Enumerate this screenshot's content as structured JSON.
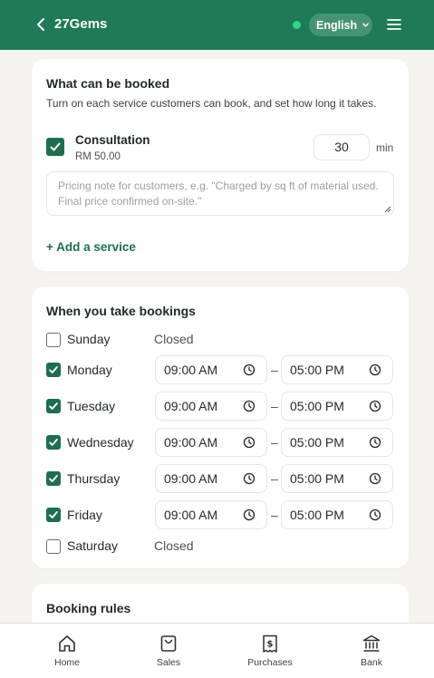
{
  "header": {
    "title": "27Gems",
    "language": "English",
    "colors": {
      "bar": "#1e7a57",
      "status_dot": "#2fd67f"
    }
  },
  "services_card": {
    "title": "What can be booked",
    "subtitle": "Turn on each service customers can book, and set how long it takes.",
    "services": [
      {
        "name": "Consultation",
        "price": "RM 50.00",
        "enabled": true,
        "duration": "30",
        "duration_unit": "min",
        "note_placeholder": "Pricing note for customers, e.g. \"Charged by sq ft of material used. Final price confirmed on-site.\""
      }
    ],
    "add_label": "+ Add a service"
  },
  "hours_card": {
    "title": "When you take bookings",
    "closed_label": "Closed",
    "separator": "–",
    "days": [
      {
        "name": "Sunday",
        "enabled": false,
        "start": "",
        "end": ""
      },
      {
        "name": "Monday",
        "enabled": true,
        "start": "09:00 AM",
        "end": "05:00 PM"
      },
      {
        "name": "Tuesday",
        "enabled": true,
        "start": "09:00 AM",
        "end": "05:00 PM"
      },
      {
        "name": "Wednesday",
        "enabled": true,
        "start": "09:00 AM",
        "end": "05:00 PM"
      },
      {
        "name": "Thursday",
        "enabled": true,
        "start": "09:00 AM",
        "end": "05:00 PM"
      },
      {
        "name": "Friday",
        "enabled": true,
        "start": "09:00 AM",
        "end": "05:00 PM"
      },
      {
        "name": "Saturday",
        "enabled": false,
        "start": "",
        "end": ""
      }
    ]
  },
  "rules_card": {
    "title": "Booking rules"
  },
  "bottom_nav": {
    "items": [
      {
        "label": "Home",
        "icon": "home-icon"
      },
      {
        "label": "Sales",
        "icon": "shopping-bag-icon"
      },
      {
        "label": "Purchases",
        "icon": "receipt-icon"
      },
      {
        "label": "Bank",
        "icon": "bank-icon"
      }
    ]
  },
  "accent_color": "#1e6e50"
}
